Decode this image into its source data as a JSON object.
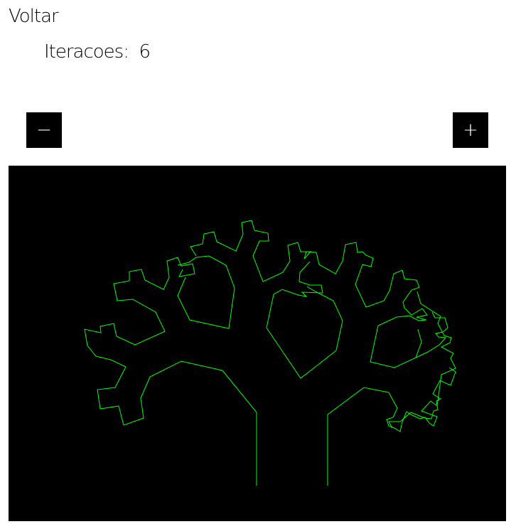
{
  "nav": {
    "back_label": "Voltar"
  },
  "iterations": {
    "label": "Iteracoes:",
    "value": "6"
  },
  "controls": {
    "decrement_label": "−",
    "increment_label": "+"
  },
  "canvas": {
    "background": "#000000",
    "stroke_color": "#00ff00"
  }
}
